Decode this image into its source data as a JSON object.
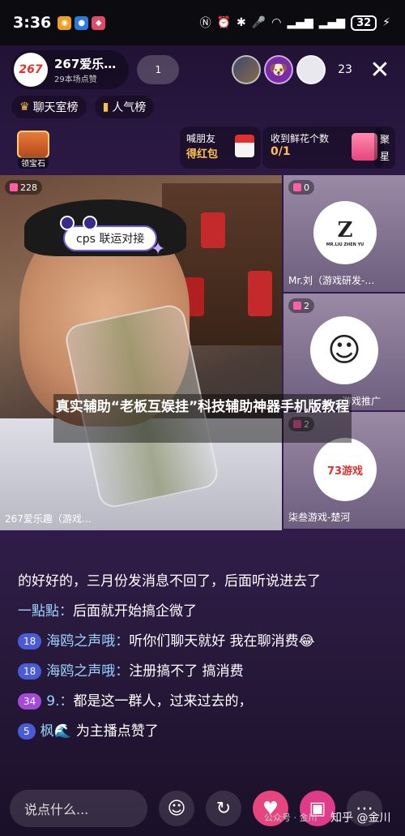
{
  "status": {
    "time": "3:36",
    "battery": "32"
  },
  "header": {
    "host_logo": "267",
    "host_name": "267爱乐…",
    "host_sub": "29本场点赞",
    "follow_count": "1",
    "viewer_count": "23"
  },
  "ranks": [
    "聊天室榜",
    "人气榜"
  ],
  "tasks": {
    "chest_label": "领宝石",
    "invite_a": "喊朋友",
    "invite_b": "得红包",
    "flower_a": "收到鲜花个数",
    "flower_b": "0/1",
    "vert_a": "聚",
    "vert_b": "星"
  },
  "video": {
    "main_count": "228",
    "main_name": "267爱乐趣（游戏…",
    "sticker": "cps 联运对接",
    "side": [
      {
        "count": "0",
        "name": "Mr.刘（游戏研发-…",
        "logo": "MR.LIU ZHEN YU"
      },
      {
        "count": "2",
        "name": "游戏推广",
        "logo": ""
      },
      {
        "count": "2",
        "name": "柒叁游戏-楚河",
        "logo": "73游戏"
      }
    ]
  },
  "caption": "真实辅助“老板互娱挂”科技辅助神器手机版教程",
  "chat": [
    {
      "level": "",
      "user": "",
      "text": "的好好的，三月份发消息不回了，后面听说进去了"
    },
    {
      "level": "",
      "user": "一點點：",
      "text": "后面就开始搞企微了"
    },
    {
      "level": "18",
      "user": "海鸥之声哦：",
      "text": "听你们聊天就好 我在聊消费😂"
    },
    {
      "level": "18",
      "user": "海鸥之声哦：",
      "text": "注册搞不了 搞消费"
    },
    {
      "level": "34",
      "user": "9.：",
      "text": "都是这一群人，过来过去的，"
    },
    {
      "level": "5",
      "user": "枫🌊",
      "text": "为主播点赞了"
    }
  ],
  "bottom": {
    "placeholder": "说点什么...",
    "wm1": "公众号 · 金川",
    "wm2": "知乎 @金川"
  },
  "colors": {
    "accent": "#ffc14d",
    "username": "#9ad3ff"
  }
}
